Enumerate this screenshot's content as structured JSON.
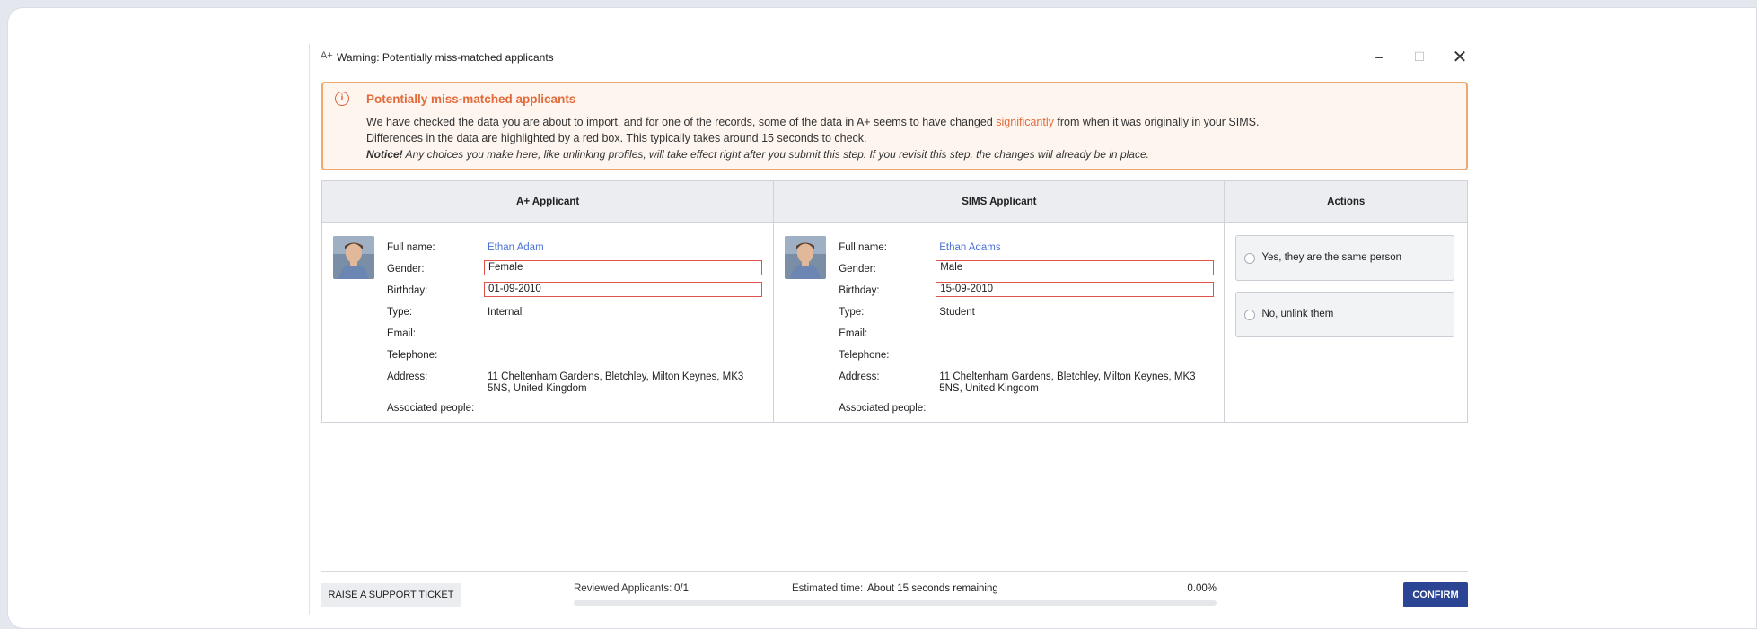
{
  "window": {
    "app_icon": "A+",
    "title": "Warning: Potentially miss-matched applicants",
    "minimize": "–",
    "maximize": "☐",
    "close": "✕"
  },
  "banner": {
    "icon": "i",
    "title": "Potentially miss-matched applicants",
    "line1_before": "We have checked the data you are about to import, and for one of the records, some of the data in A+ seems to have changed ",
    "line1_link": "significantly",
    "line1_after": " from when it was originally in your SIMS.",
    "line2": "Differences in the data are highlighted by a red box. This typically takes around 15 seconds to check.",
    "line3_strong": "Notice!",
    "line3_rest": " Any choices you make here, like unlinking profiles, will take effect right after you submit this step. If you revisit this step, the changes will already be in place."
  },
  "columns": {
    "aplus": "A+ Applicant",
    "sims": "SIMS Applicant",
    "actions": "Actions"
  },
  "labels": {
    "full_name": "Full name:",
    "gender": "Gender:",
    "birthday": "Birthday:",
    "type": "Type:",
    "email": "Email:",
    "telephone": "Telephone:",
    "address": "Address:",
    "associated": "Associated people:"
  },
  "aplus": {
    "full_name": "Ethan Adam",
    "gender": "Female",
    "birthday": "01-09-2010",
    "type": "Internal",
    "email": "",
    "telephone": "",
    "address": "11 Cheltenham Gardens, Bletchley, Milton Keynes, MK3 5NS, United Kingdom",
    "associated": ""
  },
  "sims": {
    "full_name": "Ethan Adams",
    "gender": "Male",
    "birthday": "15-09-2010",
    "type": "Student",
    "email": "",
    "telephone": "",
    "address": "11 Cheltenham Gardens, Bletchley, Milton Keynes, MK3 5NS, United Kingdom",
    "associated": ""
  },
  "actions": {
    "same": "Yes, they are the same person",
    "unlink": "No, unlink them"
  },
  "footer": {
    "support": "RAISE A SUPPORT TICKET",
    "reviewed_label": "Reviewed Applicants:",
    "reviewed_value": "0/1",
    "estimated_label": "Estimated time:",
    "estimated_value": "About 15 seconds remaining",
    "percent": "0.00%",
    "progress_fraction": 0,
    "confirm": "CONFIRM"
  },
  "colors": {
    "accent": "#2c4494",
    "warning": "#e36a3a",
    "diff_border": "#e0534b",
    "link": "#4a72d6"
  }
}
